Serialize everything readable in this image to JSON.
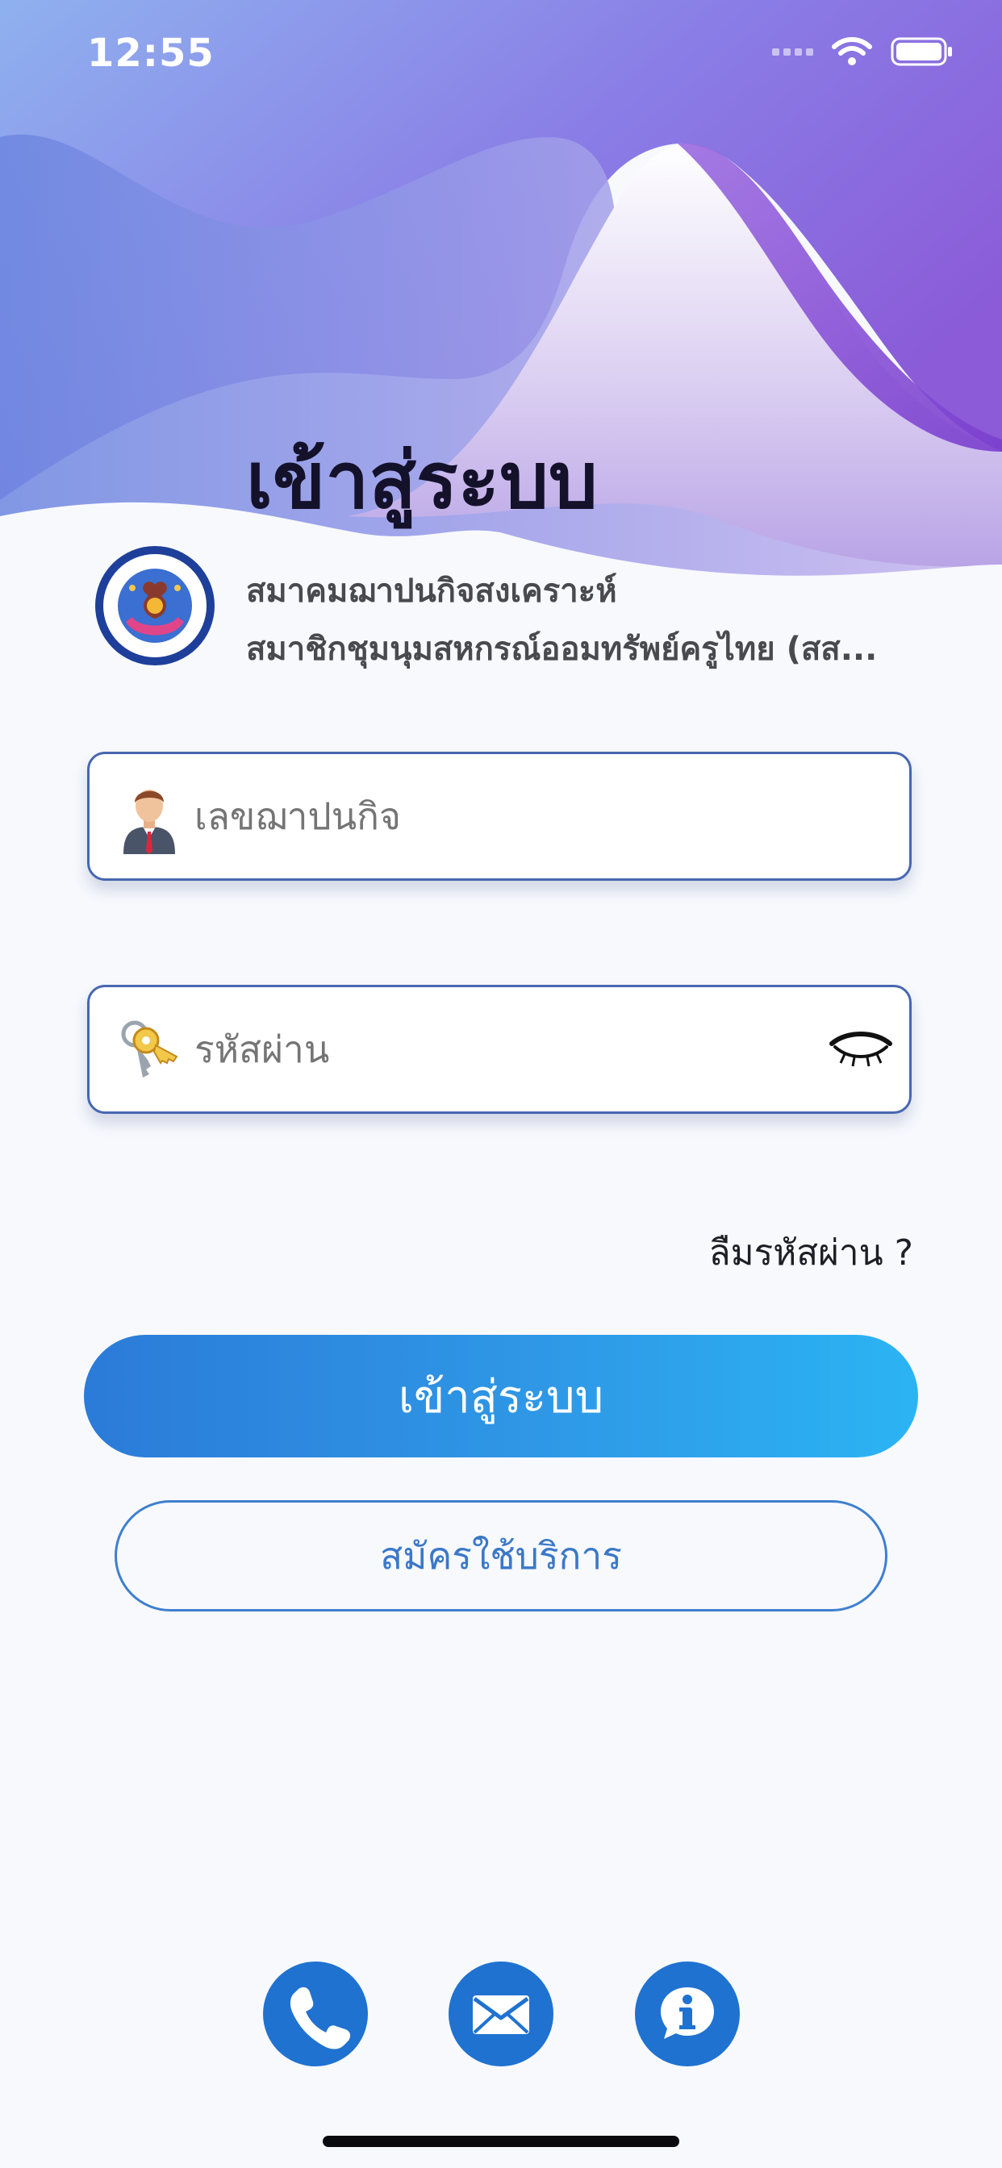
{
  "status_bar": {
    "time": "12:55"
  },
  "login": {
    "title": "เข้าสู่ระบบ",
    "org_name_line1": "สมาคมฌาปนกิจสงเคราะห์",
    "org_name_line2": "สมาชิกชุมนุมสหกรณ์ออมทรัพย์ครูไทย (สส..."
  },
  "form": {
    "member_id_placeholder": "เลขฌาปนกิจ",
    "password_placeholder": "รหัสผ่าน",
    "forgot_password": "ลืมรหัสผ่าน ?",
    "login_button": "เข้าสู่ระบบ",
    "register_button": "สมัครใช้บริการ"
  },
  "footer": {
    "icons": [
      "phone-icon",
      "mail-icon",
      "info-icon"
    ]
  },
  "colors": {
    "primary": "#1f72d0",
    "accent_gradient_start": "#2b7bd8",
    "accent_gradient_end": "#2bb4f4",
    "field_border": "#4767b0"
  }
}
